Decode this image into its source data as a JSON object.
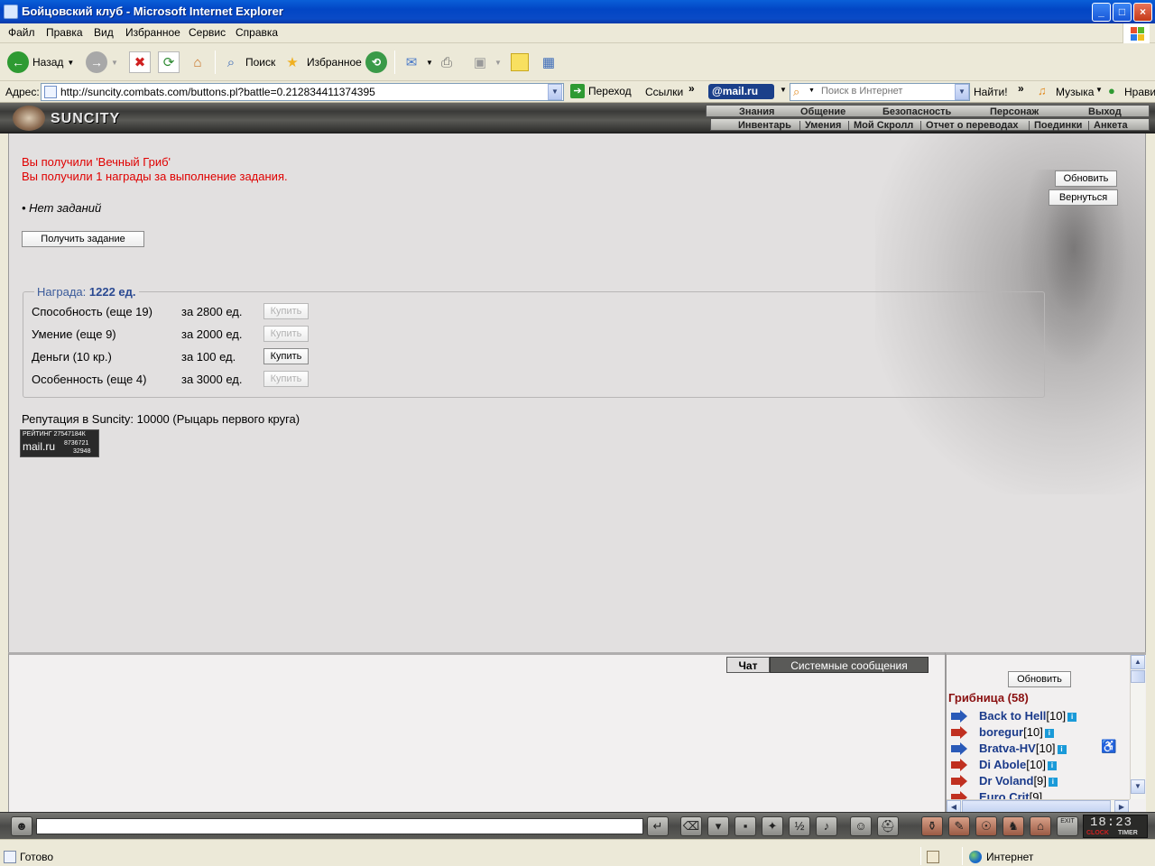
{
  "window": {
    "title": "Бойцовский клуб - Microsoft Internet Explorer",
    "minimize": "_",
    "maximize": "□",
    "close": "×"
  },
  "menu": [
    "Файл",
    "Правка",
    "Вид",
    "Избранное",
    "Сервис",
    "Справка"
  ],
  "toolbar": {
    "back": "Назад",
    "search": "Поиск",
    "favorites": "Избранное"
  },
  "address": {
    "label": "Адрес:",
    "url": "http://suncity.combats.com/buttons.pl?battle=0.212834411374395",
    "go": "Переход",
    "links": "Ссылки",
    "mailru": "@mail.ru",
    "search_placeholder": "Поиск в Интернет",
    "find": "Найти!",
    "music": "Музыка",
    "nrav": "Нрави"
  },
  "game": {
    "logo": "SUNCITY",
    "nav_top": [
      "Знания",
      "Общение",
      "Безопасность",
      "Персонаж",
      "Выход"
    ],
    "nav_bottom": [
      "Инвентарь",
      "Умения",
      "Мой Скролл",
      "Отчет о переводах",
      "Поединки",
      "Анкета"
    ]
  },
  "main": {
    "message1": "Вы получили 'Вечный Гриб'",
    "message2": "Вы получили 1 награды за выполнение задания.",
    "no_tasks": "• Нет заданий",
    "get_task": "Получить задание",
    "refresh": "Обновить",
    "back": "Вернуться",
    "reward_label": "Награда:",
    "reward_value": "1222 ед.",
    "reward_rows": [
      {
        "name": "Способность (еще 19)",
        "price": "за 2800 ед.",
        "buy": "Купить",
        "enabled": false
      },
      {
        "name": "Умение (еще 9)",
        "price": "за 2000 ед.",
        "buy": "Купить",
        "enabled": false
      },
      {
        "name": "Деньги (10 кр.)",
        "price": "за 100 ед.",
        "buy": "Купить",
        "enabled": true
      },
      {
        "name": "Особенность (еще 4)",
        "price": "за 3000 ед.",
        "buy": "Купить",
        "enabled": false
      }
    ],
    "reputation": "Репутация в Suncity: 10000 (Рыцарь первого круга)",
    "counter": {
      "line1": "РЕЙТИНГ 27547184К",
      "brand": "mail.ru",
      "n1": "8736721",
      "n2": "32948"
    }
  },
  "chat": {
    "tab_chat": "Чат",
    "tab_system": "Системные сообщения"
  },
  "userlist": {
    "refresh": "Обновить",
    "room": "Грибница (58)",
    "users": [
      {
        "name": "Back to Hell",
        "level": "[10]",
        "icon_color": "#2a5ab8"
      },
      {
        "name": "boregur",
        "level": "[10]",
        "icon_color": "#c03020"
      },
      {
        "name": "Bratva-HV",
        "level": "[10]",
        "icon_color": "#2a5ab8"
      },
      {
        "name": "Di Abole",
        "level": "[10]",
        "icon_color": "#c03020"
      },
      {
        "name": "Dr Voland",
        "level": "[9]",
        "icon_color": "#c03020"
      },
      {
        "name": "Euro Crit",
        "level": "[9]",
        "icon_color": "#c03020"
      }
    ]
  },
  "gamebar": {
    "time": "18:23",
    "clock_label": "CLOCK",
    "timer_label": "TIMER",
    "exit": "EXIT"
  },
  "status": {
    "text": "Готово",
    "zone": "Интернет"
  }
}
